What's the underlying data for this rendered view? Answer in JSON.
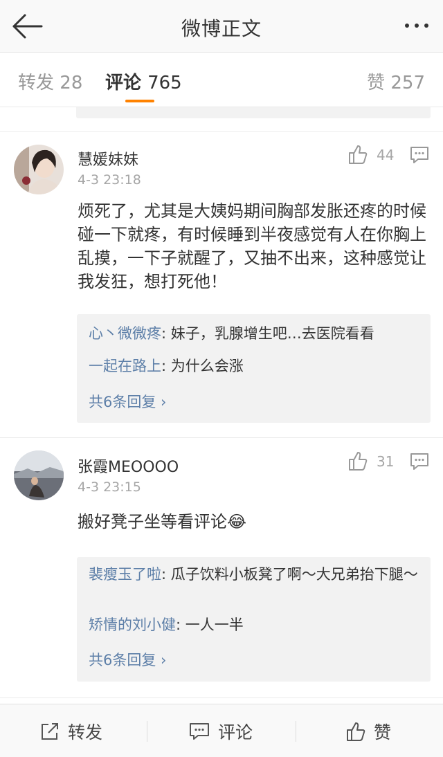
{
  "header": {
    "title": "微博正文",
    "back_icon": "back-arrow-icon",
    "more_icon": "more-dots-icon"
  },
  "tabs": {
    "repost": {
      "label": "转发",
      "count": "28"
    },
    "comment": {
      "label": "评论",
      "count": "765",
      "active": true,
      "accent": "#ff8200"
    },
    "like": {
      "label": "赞",
      "count": "257"
    }
  },
  "comments": [
    {
      "author": "慧媛妹妹",
      "time": "4-3 23:18",
      "likes": "44",
      "text": "烦死了，尤其是大姨妈期间胸部发胀还疼的时候碰一下就疼，有时候睡到半夜感觉有人在你胸上乱摸，一下子就醒了，又抽不出来，这种感觉让我发狂，想打死他！",
      "replies": [
        {
          "name": "心丶微微疼",
          "text": ": 妹子，乳腺增生吧…去医院看看"
        },
        {
          "name": "一起在路上",
          "text": ": 为什么会涨"
        }
      ],
      "total": "共6条回复 ›"
    },
    {
      "author": "张霞MEOOOO",
      "time": "4-3 23:15",
      "likes": "31",
      "text": "搬好凳子坐等看评论😂",
      "replies": [
        {
          "name": "裴瘦玉了啦",
          "text": ": 瓜子饮料小板凳了啊～大兄弟抬下腿～"
        },
        {
          "name": "矫情的刘小健",
          "text": ": 一人一半"
        }
      ],
      "total": "共6条回复 ›"
    }
  ],
  "bottom_bar": {
    "repost": "转发",
    "comment": "评论",
    "like": "赞"
  },
  "colors": {
    "link": "#5d7fa8",
    "accent": "#ff8200",
    "meta": "#a6a6a6"
  }
}
